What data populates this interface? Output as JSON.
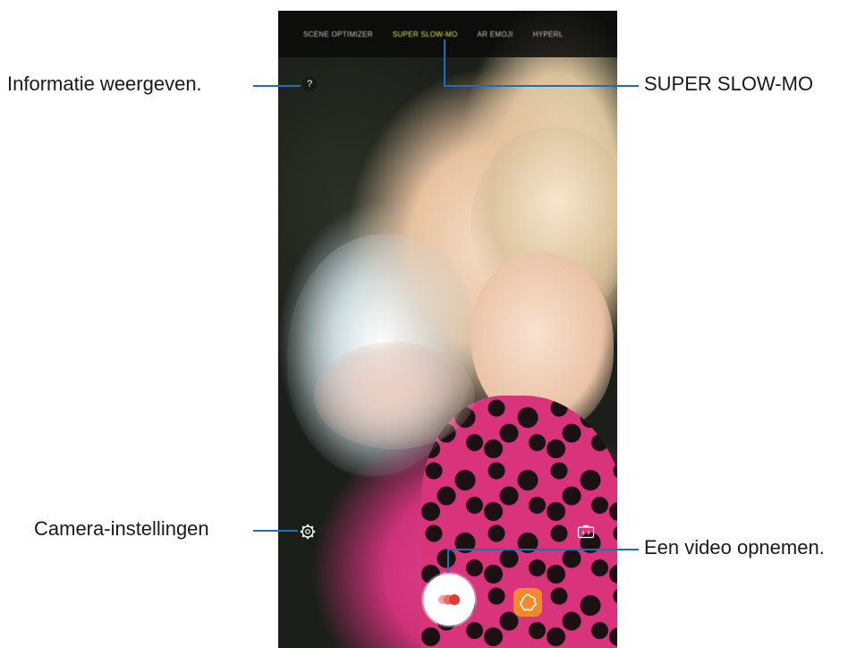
{
  "camera": {
    "modes": [
      "SCENE OPTIMIZER",
      "SUPER SLOW-MO",
      "AR EMOJI",
      "HYPERL"
    ],
    "active_mode_index": 1,
    "info_glyph": "?",
    "icons": {
      "info": "question-mark-icon",
      "settings": "gear-icon",
      "switch_camera": "switch-camera-icon",
      "record": "record-icon",
      "gallery": "gallery-icon"
    }
  },
  "callouts": {
    "info": "Informatie weergeven.",
    "settings": "Camera-instellingen",
    "mode": "SUPER SLOW-MO",
    "record": "Een video opnemen."
  },
  "colors": {
    "leader_line": "#1f6fb5",
    "active_mode": "#e2e65a",
    "record_dot": "#e53935",
    "gallery_button": "#f18a2c"
  }
}
